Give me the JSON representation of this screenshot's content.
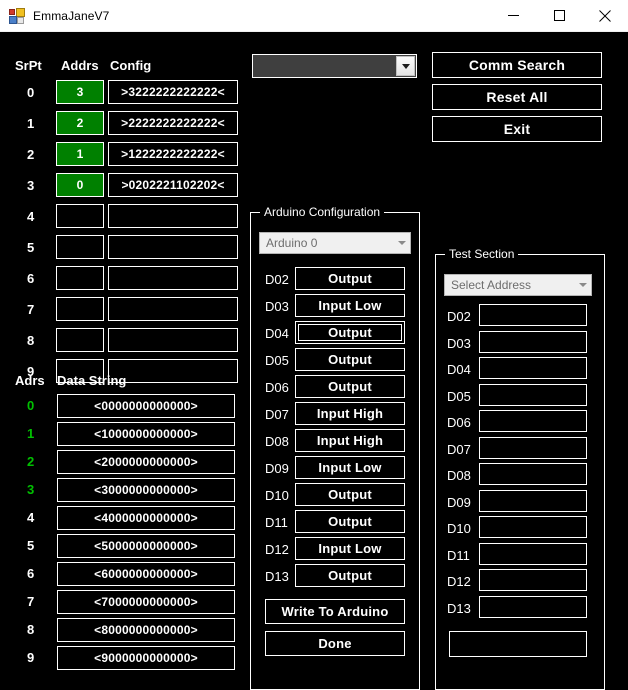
{
  "window": {
    "title": "EmmaJaneV7",
    "icon": "app-window-icon",
    "minimize_label": "–",
    "maximize_label": "□",
    "close_label": "×"
  },
  "colors": {
    "background": "#000000",
    "foreground": "#FFFFFF",
    "addr_fill": "#008000",
    "addr_text_green": "#00C000",
    "combo_dark": "#3F3F3F",
    "combo_light": "#F0F0F0"
  },
  "serial_table": {
    "headers": {
      "srpt": "SrPt",
      "addrs": "Addrs",
      "config": "Config"
    },
    "rows": [
      {
        "srpt": "0",
        "addrs": "3",
        "addrs_active": true,
        "config": ">3222222222222<"
      },
      {
        "srpt": "1",
        "addrs": "2",
        "addrs_active": true,
        "config": ">2222222222222<"
      },
      {
        "srpt": "2",
        "addrs": "1",
        "addrs_active": true,
        "config": ">1222222222222<"
      },
      {
        "srpt": "3",
        "addrs": "0",
        "addrs_active": true,
        "config": ">0202221102202<"
      },
      {
        "srpt": "4",
        "addrs": "",
        "addrs_active": false,
        "config": ""
      },
      {
        "srpt": "5",
        "addrs": "",
        "addrs_active": false,
        "config": ""
      },
      {
        "srpt": "6",
        "addrs": "",
        "addrs_active": false,
        "config": ""
      },
      {
        "srpt": "7",
        "addrs": "",
        "addrs_active": false,
        "config": ""
      },
      {
        "srpt": "8",
        "addrs": "",
        "addrs_active": false,
        "config": ""
      },
      {
        "srpt": "9",
        "addrs": "",
        "addrs_active": false,
        "config": ""
      }
    ]
  },
  "data_table": {
    "headers": {
      "adrs": "Adrs",
      "data_string": "Data String"
    },
    "rows": [
      {
        "adrs": "0",
        "green": true,
        "value": "<0000000000000>"
      },
      {
        "adrs": "1",
        "green": true,
        "value": "<1000000000000>"
      },
      {
        "adrs": "2",
        "green": true,
        "value": "<2000000000000>"
      },
      {
        "adrs": "3",
        "green": true,
        "value": "<3000000000000>"
      },
      {
        "adrs": "4",
        "green": false,
        "value": "<4000000000000>"
      },
      {
        "adrs": "5",
        "green": false,
        "value": "<5000000000000>"
      },
      {
        "adrs": "6",
        "green": false,
        "value": "<6000000000000>"
      },
      {
        "adrs": "7",
        "green": false,
        "value": "<7000000000000>"
      },
      {
        "adrs": "8",
        "green": false,
        "value": "<8000000000000>"
      },
      {
        "adrs": "9",
        "green": false,
        "value": "<9000000000000>"
      }
    ]
  },
  "comm_port": {
    "selected": "",
    "placeholder": "",
    "arrow_icon": "chevron-down-icon"
  },
  "top_buttons": {
    "comm_search": "Comm Search",
    "reset_all": "Reset All",
    "exit": "Exit"
  },
  "arduino_config": {
    "title": "Arduino Configuration",
    "board_select": {
      "selected": "Arduino 0",
      "arrow_icon": "chevron-down-icon"
    },
    "pins": [
      {
        "label": "D02",
        "state": "Output",
        "focused": false
      },
      {
        "label": "D03",
        "state": "Input Low",
        "focused": false
      },
      {
        "label": "D04",
        "state": "Output",
        "focused": true
      },
      {
        "label": "D05",
        "state": "Output",
        "focused": false
      },
      {
        "label": "D06",
        "state": "Output",
        "focused": false
      },
      {
        "label": "D07",
        "state": "Input High",
        "focused": false
      },
      {
        "label": "D08",
        "state": "Input High",
        "focused": false
      },
      {
        "label": "D09",
        "state": "Input Low",
        "focused": false
      },
      {
        "label": "D10",
        "state": "Output",
        "focused": false
      },
      {
        "label": "D11",
        "state": "Output",
        "focused": false
      },
      {
        "label": "D12",
        "state": "Input Low",
        "focused": false
      },
      {
        "label": "D13",
        "state": "Output",
        "focused": false
      }
    ],
    "write_button": "Write To Arduino",
    "done_button": "Done"
  },
  "test_section": {
    "title": "Test Section",
    "address_select": {
      "selected": "Select Address",
      "arrow_icon": "chevron-down-icon"
    },
    "pins": [
      {
        "label": "D02",
        "value": ""
      },
      {
        "label": "D03",
        "value": ""
      },
      {
        "label": "D04",
        "value": ""
      },
      {
        "label": "D05",
        "value": ""
      },
      {
        "label": "D06",
        "value": ""
      },
      {
        "label": "D07",
        "value": ""
      },
      {
        "label": "D08",
        "value": ""
      },
      {
        "label": "D09",
        "value": ""
      },
      {
        "label": "D10",
        "value": ""
      },
      {
        "label": "D11",
        "value": ""
      },
      {
        "label": "D12",
        "value": ""
      },
      {
        "label": "D13",
        "value": ""
      }
    ],
    "status_field": ""
  }
}
